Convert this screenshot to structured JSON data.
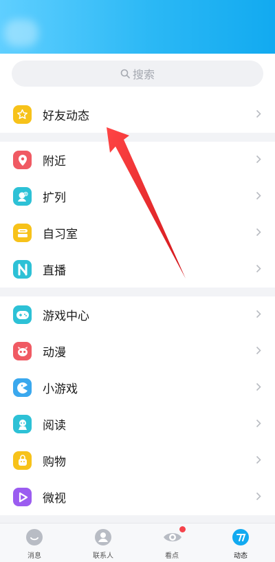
{
  "search": {
    "placeholder": "搜索"
  },
  "sections": [
    {
      "items": [
        {
          "label": "好友动态",
          "icon": "star-icon",
          "color": "#f7c21a"
        }
      ]
    },
    {
      "items": [
        {
          "label": "附近",
          "icon": "location-pin-icon",
          "color": "#f05a63"
        },
        {
          "label": "扩列",
          "icon": "person-plus-icon",
          "color": "#2dc1d6"
        },
        {
          "label": "自习室",
          "icon": "study-room-icon",
          "color": "#f7c21a"
        },
        {
          "label": "直播",
          "icon": "live-icon",
          "color": "#2dc1d6"
        }
      ]
    },
    {
      "items": [
        {
          "label": "游戏中心",
          "icon": "gamepad-icon",
          "color": "#2dc1d6"
        },
        {
          "label": "动漫",
          "icon": "anime-icon",
          "color": "#f05a63"
        },
        {
          "label": "小游戏",
          "icon": "pacman-icon",
          "color": "#3aa8ee"
        },
        {
          "label": "阅读",
          "icon": "reading-icon",
          "color": "#2dc1d6"
        },
        {
          "label": "购物",
          "icon": "shopping-icon",
          "color": "#f7c21a"
        },
        {
          "label": "微视",
          "icon": "play-icon",
          "color": "#9b5cf0"
        }
      ]
    }
  ],
  "tabs": [
    {
      "label": "消息",
      "icon": "message-icon"
    },
    {
      "label": "联系人",
      "icon": "contacts-icon"
    },
    {
      "label": "看点",
      "icon": "eye-icon",
      "badge": true
    },
    {
      "label": "动态",
      "icon": "moments-icon",
      "active": true
    }
  ],
  "colors": {
    "header_start": "#5fcfff",
    "header_end": "#12aaf0",
    "arrow": "#e8181d",
    "accent": "#12aaf0"
  }
}
